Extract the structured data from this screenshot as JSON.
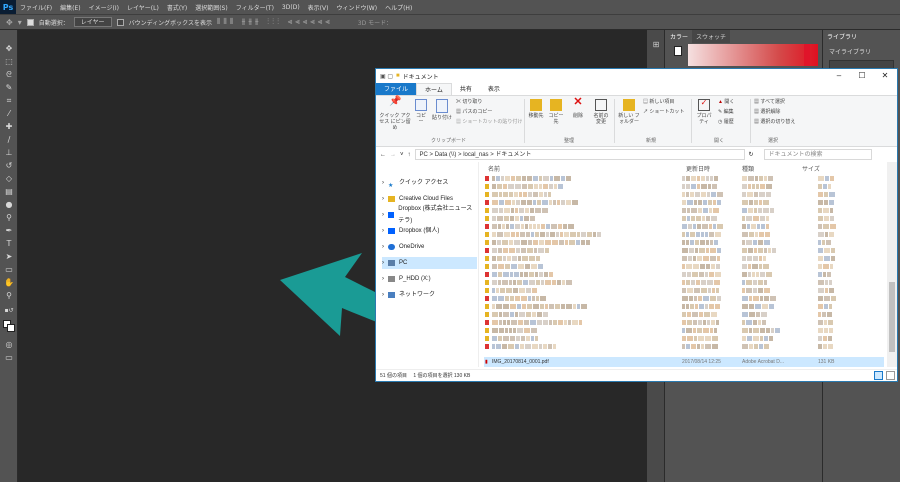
{
  "app": {
    "logo": "Ps",
    "menus": [
      "ファイル(F)",
      "編集(E)",
      "イメージ(I)",
      "レイヤー(L)",
      "書式(Y)",
      "選択範囲(S)",
      "フィルター(T)",
      "3D(D)",
      "表示(V)",
      "ウィンドウ(W)",
      "ヘルプ(H)"
    ]
  },
  "options": {
    "auto_select": "自動選択：",
    "layer": "レイヤー",
    "bbox": "バウンディングボックスを表示",
    "mode3d": "3D モード："
  },
  "panels": {
    "color_tab": "カラー",
    "swatch_tab": "スウォッチ",
    "library_tab": "ライブラリ",
    "my_library": "マイライブラリ"
  },
  "explorer": {
    "title": "ドキュメント",
    "tabs": [
      "ファイル",
      "ホーム",
      "共有",
      "表示"
    ],
    "ribbon": {
      "quick_access": "クイック アクセス にピン留め",
      "copy": "コピー",
      "paste": "貼り付け",
      "cut": "切り取り",
      "copy_path": "パスのコピー",
      "paste_shortcut": "ショートカットの貼り付け",
      "move_to": "移動先",
      "copy_to": "コピー先",
      "delete": "削除",
      "rename": "名前の変更",
      "new_folder": "新しい フォルダー",
      "new_item": "新しい項目",
      "shortcut": "ショートカット",
      "properties": "プロパティ",
      "open": "開く",
      "edit": "編集",
      "history": "履歴",
      "select_all": "すべて選択",
      "select_none": "選択解除",
      "invert": "選択の切り替え",
      "grp_clipboard": "クリップボード",
      "grp_organize": "整理",
      "grp_new": "新規",
      "grp_open": "開く",
      "grp_select": "選択"
    },
    "address": "PC  >  Data (\\\\)  >  local_nas  >  ドキュメント",
    "search_placeholder": "ドキュメントの検索",
    "columns": [
      "名前",
      "更新日時",
      "種類",
      "サイズ"
    ],
    "nav": [
      "クイック アクセス",
      "Creative Cloud Files",
      "Dropbox (株式会社ニューステラ)",
      "Dropbox (個人)",
      "OneDrive",
      "PC",
      "P_HDD (X:)",
      "ネットワーク"
    ],
    "selected_file": {
      "name": "IMG_20170814_0001.pdf",
      "date": "2017/08/14 12:25",
      "type": "Adobe Acrobat D...",
      "size": "131 KB"
    },
    "status": "51 個の項目　 1 個の項目を選択  130 KB"
  },
  "colors": {
    "arrow": "#1a9b95",
    "ps_bg": "#535353",
    "canvas": "#282828",
    "accent": "#1979ca"
  }
}
